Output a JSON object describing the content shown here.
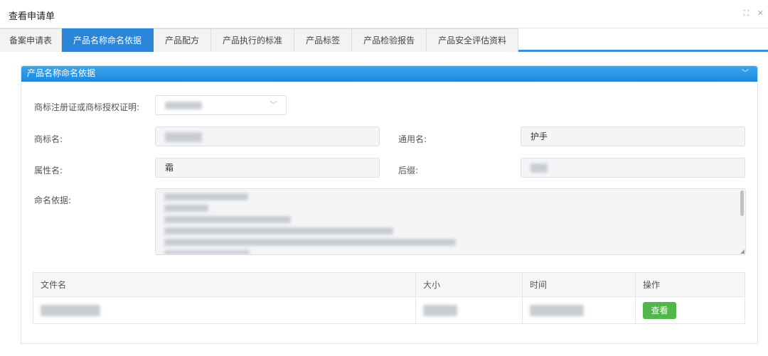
{
  "window": {
    "title": "查看申请单",
    "controls": "⛶ ✕"
  },
  "tabs": [
    {
      "label": "备案申请表",
      "active": false
    },
    {
      "label": "产品名称命名依据",
      "active": true
    },
    {
      "label": "产品配方",
      "active": false
    },
    {
      "label": "产品执行的标准",
      "active": false
    },
    {
      "label": "产品标签",
      "active": false
    },
    {
      "label": "产品检验报告",
      "active": false
    },
    {
      "label": "产品安全评估资料",
      "active": false
    }
  ],
  "panel": {
    "title": "产品名称命名依据",
    "collapse_icon": "﹀",
    "form": {
      "trademark_proof_label": "商标注册证或商标授权证明:",
      "trademark_name_label": "商标名:",
      "generic_name_label": "通用名:",
      "generic_name_value": "护手",
      "attribute_name_label": "属性名:",
      "attribute_name_value": "霜",
      "suffix_label": "后缀:",
      "naming_basis_label": "命名依据:"
    },
    "files_table": {
      "headers": [
        "文件名",
        "大小",
        "时间",
        "操作"
      ],
      "view_label": "查看"
    }
  },
  "colors": {
    "accent": "#2b86d9",
    "view_button": "#52b64c"
  }
}
